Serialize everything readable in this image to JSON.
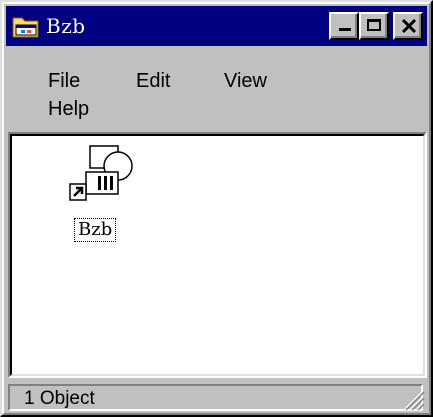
{
  "window": {
    "title": "Bzb"
  },
  "icons": {
    "app": "folder-icon",
    "minimize": "minimize-icon",
    "maximize": "maximize-icon",
    "close": "close-icon",
    "file": "shortcut-icon",
    "grip": "resize-grip-icon"
  },
  "menu": {
    "items": [
      "File",
      "Edit",
      "View",
      "Help"
    ]
  },
  "content": {
    "items": [
      {
        "label": "Bzb"
      }
    ]
  },
  "status": {
    "text": "1 Object"
  },
  "colors": {
    "titlebar": "#000080",
    "face": "#c0c0c0",
    "content_bg": "#ffffff"
  }
}
